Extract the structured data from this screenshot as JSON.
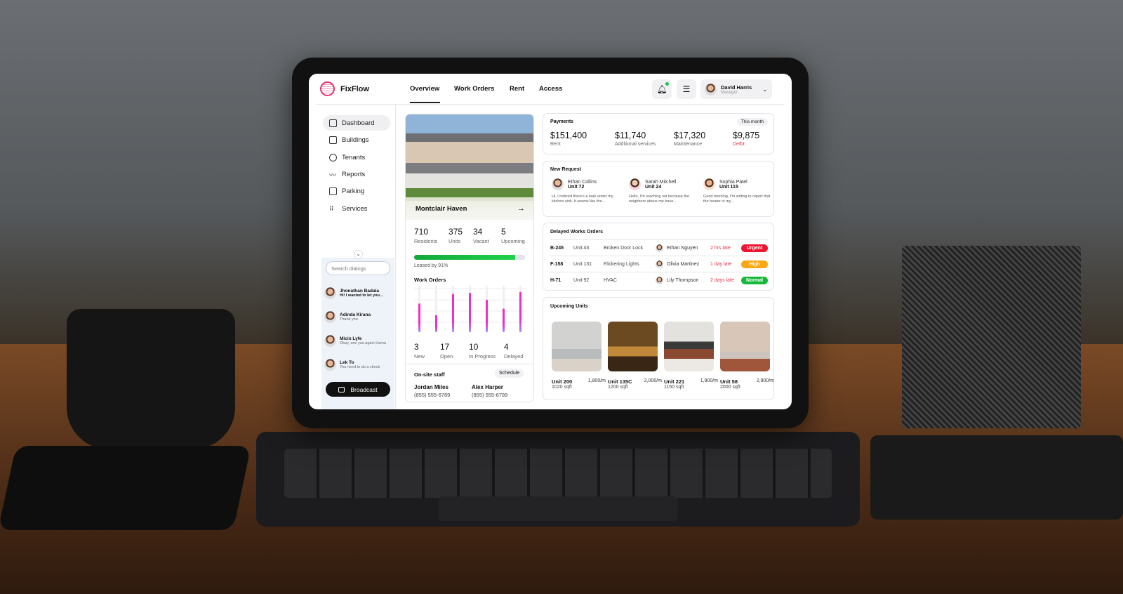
{
  "app": {
    "name": "FixFlow",
    "brand_color": "#e8336f"
  },
  "header": {
    "tabs": [
      {
        "label": "Overview",
        "active": true
      },
      {
        "label": "Work Orders"
      },
      {
        "label": "Rent"
      },
      {
        "label": "Access"
      }
    ],
    "notification_icon": "bell-icon",
    "notification_dot": true,
    "filter_icon": "sliders-icon",
    "user": {
      "name": "David Harris",
      "role": "Manager"
    }
  },
  "sidebar": {
    "items": [
      {
        "label": "Dashboard",
        "icon": "dashboard-icon",
        "active": true
      },
      {
        "label": "Buildings",
        "icon": "buildings-icon"
      },
      {
        "label": "Tenants",
        "icon": "tenants-icon"
      },
      {
        "label": "Reports",
        "icon": "chart-line-icon"
      },
      {
        "label": "Parking",
        "icon": "car-icon"
      },
      {
        "label": "Services",
        "icon": "grid-icon"
      }
    ],
    "search_placeholder": "Search dialogs",
    "chats": [
      {
        "name": "Jhonathan Badala",
        "message": "Hi! I wanted to let you...",
        "unread": true
      },
      {
        "name": "Adinda Kirana",
        "message": "Thank you",
        "online": true
      },
      {
        "name": "Micin Lyfe",
        "message": "Okay, see you again Hama"
      },
      {
        "name": "Lek To",
        "message": "You need to do a check"
      }
    ],
    "broadcast_label": "Broadcast"
  },
  "property": {
    "name": "Montclair Haven",
    "stats": [
      {
        "value": "710",
        "label": "Residents"
      },
      {
        "value": "375",
        "label": "Units"
      },
      {
        "value": "34",
        "label": "Vacant"
      },
      {
        "value": "5",
        "label": "Upcoming"
      }
    ],
    "leased_percent": 91,
    "leased_label": "Leased by 91%",
    "work_orders_title": "Work Orders",
    "work_orders": [
      {
        "value": "3",
        "label": "New"
      },
      {
        "value": "17",
        "label": "Open"
      },
      {
        "value": "10",
        "label": "In Progress"
      },
      {
        "value": "4",
        "label": "Delayed"
      }
    ],
    "staff_title": "On-site staff",
    "schedule_label": "Schedule",
    "staff": [
      {
        "name": "Jordan Miles",
        "phone": "(855) 555-6789"
      },
      {
        "name": "Alex Harper",
        "phone": "(855) 555-6789"
      }
    ]
  },
  "chart_data": {
    "type": "bar",
    "values": [
      62,
      37,
      83,
      85,
      70,
      51,
      87
    ],
    "ylim": [
      0,
      100
    ],
    "grid": true,
    "colors": [
      "#f22ec8",
      "#a78bfa"
    ]
  },
  "payments": {
    "title": "Payments",
    "period": "This month",
    "items": [
      {
        "value": "$151,400",
        "label": "Rent"
      },
      {
        "value": "$11,740",
        "label": "Additional services"
      },
      {
        "value": "$17,320",
        "label": "Maintenance"
      },
      {
        "value": "$9,875",
        "label": "Debt",
        "label_display": "Detbt",
        "color": "#e8334a"
      }
    ]
  },
  "new_request": {
    "title": "New Request",
    "items": [
      {
        "name": "Ethan Collins",
        "unit": "Unit 72",
        "message": "Hi, I noticed there's a leak under my kitchen sink. It seems like the..."
      },
      {
        "name": "Sarah Mitchell",
        "unit": "Unit 24",
        "message": "Hello, I'm reaching out because the neighbors above me have..."
      },
      {
        "name": "Sophia Patel",
        "unit": "Unit 115",
        "message": "Good morning, I'm writing to report that the heater in my..."
      }
    ]
  },
  "delayed": {
    "title": "Delayed Works Orders",
    "rows": [
      {
        "id": "B-245",
        "unit": "Unit 43",
        "issue": "Broken Door Lock",
        "assignee": "Ethan Nguyen",
        "late": "2 hrs late",
        "priority": "Urgent",
        "color": "#f0142f"
      },
      {
        "id": "F-158",
        "unit": "Unit 131",
        "issue": "Flickering Lights",
        "assignee": "Olivia Martinez",
        "late": "1 day late",
        "priority": "High",
        "color": "#f9a713"
      },
      {
        "id": "H-71",
        "unit": "Unit 92",
        "issue": "HVAC",
        "assignee": "Lily Thompson",
        "late": "2 days late",
        "priority": "Normal",
        "color": "#16b83a"
      }
    ]
  },
  "upcoming": {
    "title": "Upcoming Units",
    "units": [
      {
        "name": "Unit 200",
        "price": "1,800/m",
        "size": "1020 sqft"
      },
      {
        "name": "Unit 135C",
        "price": "2,000/m",
        "size": "1200 sqft"
      },
      {
        "name": "Unit 221",
        "price": "1,900/m",
        "size": "1150 sqft"
      },
      {
        "name": "Unit 58",
        "price": "2,900/m",
        "size": "2000 sqft"
      }
    ]
  }
}
